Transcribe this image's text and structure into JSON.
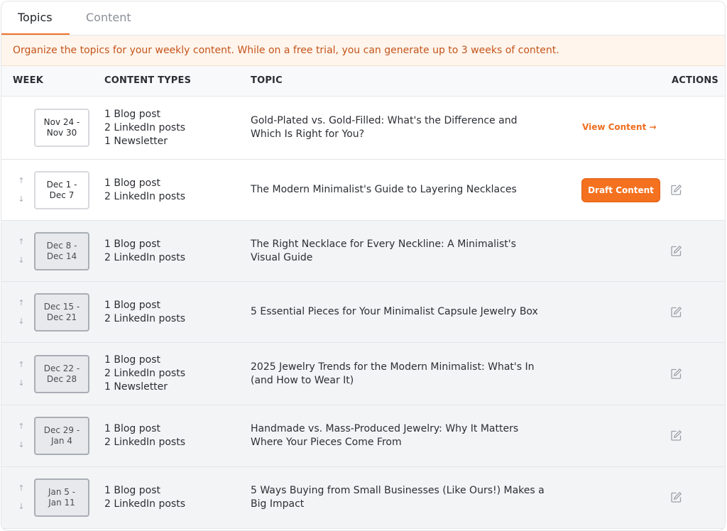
{
  "tabs": [
    {
      "label": "Topics",
      "active": true
    },
    {
      "label": "Content",
      "active": false
    }
  ],
  "banner": "Organize the topics for your weekly content. While on a free trial, you can generate up to 3 weeks of content.",
  "columns": {
    "week": "WEEK",
    "content_types": "CONTENT TYPES",
    "topic": "TOPIC",
    "actions": "ACTIONS"
  },
  "colors": {
    "accent": "#F4711F",
    "banner_text": "#C4541B",
    "banner_bg": "#FFF5EC"
  },
  "rows": [
    {
      "week": "Nov 24 -\nNov 30",
      "types": [
        "1 Blog post",
        "2 LinkedIn posts",
        "1 Newsletter"
      ],
      "topic": "Gold-Plated vs. Gold-Filled: What's the Difference and Which Is Right for You?",
      "action": "View Content →",
      "action_type": "link",
      "show_arrows": false,
      "state": "active"
    },
    {
      "week": "Dec 1 -\nDec 7",
      "types": [
        "1 Blog post",
        "2 LinkedIn posts"
      ],
      "topic": "The Modern Minimalist's Guide to Layering Necklaces",
      "action": "Draft Content",
      "action_type": "button",
      "show_arrows": true,
      "state": "active"
    },
    {
      "week": "Dec 8 -\nDec 14",
      "types": [
        "1 Blog post",
        "2 LinkedIn posts"
      ],
      "topic": "The Right Necklace for Every Neckline: A Minimalist's Visual Guide",
      "action": "",
      "action_type": "none",
      "show_arrows": true,
      "state": "inactive"
    },
    {
      "week": "Dec 15 -\nDec 21",
      "types": [
        "1 Blog post",
        "2 LinkedIn posts"
      ],
      "topic": "5 Essential Pieces for Your Minimalist Capsule Jewelry Box",
      "action": "",
      "action_type": "none",
      "show_arrows": true,
      "state": "inactive"
    },
    {
      "week": "Dec 22 -\nDec 28",
      "types": [
        "1 Blog post",
        "2 LinkedIn posts",
        "1 Newsletter"
      ],
      "topic": "2025 Jewelry Trends for the Modern Minimalist: What's In (and How to Wear It)",
      "action": "",
      "action_type": "none",
      "show_arrows": true,
      "state": "inactive"
    },
    {
      "week": "Dec 29 -\nJan 4",
      "types": [
        "1 Blog post",
        "2 LinkedIn posts"
      ],
      "topic": "Handmade vs. Mass-Produced Jewelry: Why It Matters Where Your Pieces Come From",
      "action": "",
      "action_type": "none",
      "show_arrows": true,
      "state": "inactive"
    },
    {
      "week": "Jan 5 -\nJan 11",
      "types": [
        "1 Blog post",
        "2 LinkedIn posts"
      ],
      "topic": "5 Ways Buying from Small Businesses (Like Ours!) Makes a Big Impact",
      "action": "",
      "action_type": "none",
      "show_arrows": true,
      "state": "inactive"
    }
  ]
}
